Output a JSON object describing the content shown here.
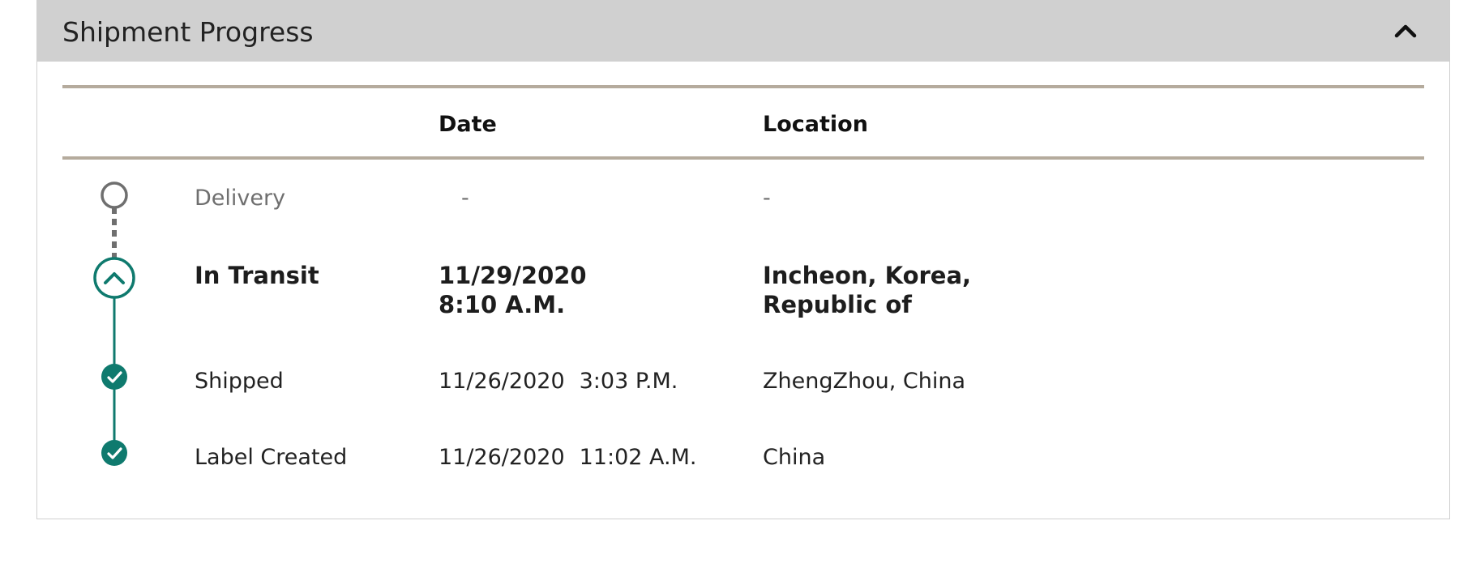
{
  "panel": {
    "title": "Shipment Progress",
    "collapse_icon": "chevron-up-icon"
  },
  "columns": {
    "date": "Date",
    "location": "Location"
  },
  "colors": {
    "accent": "#0f7a6e",
    "pending": "#6f6f6f",
    "rule": "#b5ab9d",
    "header_bg": "#d0d0d0"
  },
  "events": [
    {
      "status": "Delivery",
      "date": "-",
      "time": "",
      "location": "-",
      "state": "pending",
      "icon": "empty-circle-icon"
    },
    {
      "status": "In Transit",
      "date": "11/29/2020",
      "time": "8:10 A.M.",
      "location_line1": "Incheon, Korea,",
      "location_line2": "Republic of",
      "state": "current",
      "icon": "chevron-up-circle-icon"
    },
    {
      "status": "Shipped",
      "date": "11/26/2020",
      "time": "3:03 P.M.",
      "location": "ZhengZhou, China",
      "state": "done",
      "icon": "check-circle-icon"
    },
    {
      "status": "Label Created",
      "date": "11/26/2020",
      "time": "11:02 A.M.",
      "location": "China",
      "state": "done",
      "icon": "check-circle-icon"
    }
  ]
}
